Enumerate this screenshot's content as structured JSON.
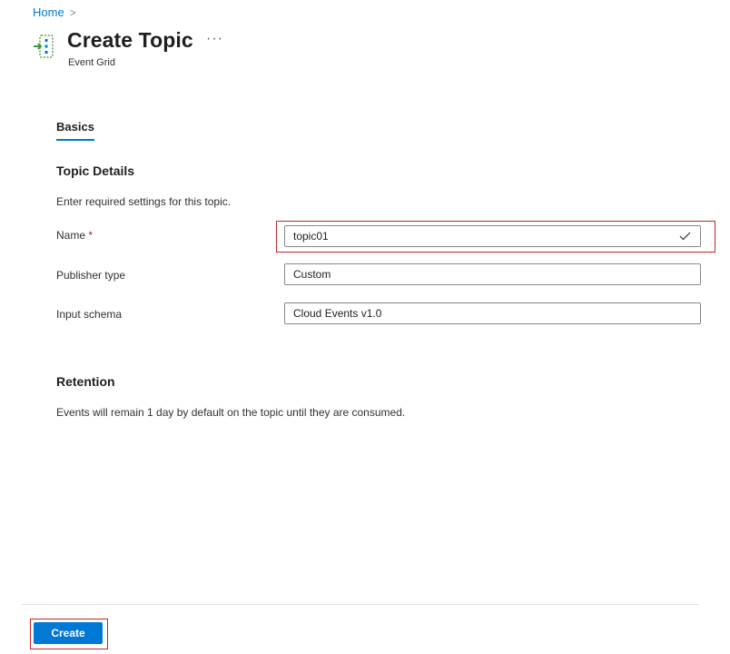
{
  "breadcrumb": {
    "home": "Home",
    "separator": ">"
  },
  "header": {
    "title": "Create Topic",
    "more": "···",
    "subtitle": "Event Grid",
    "icon": "event-grid-topic-icon"
  },
  "tabs": [
    {
      "label": "Basics",
      "active": true
    }
  ],
  "topic_details": {
    "heading": "Topic Details",
    "description": "Enter required settings for this topic.",
    "fields": {
      "name": {
        "label": "Name",
        "required_marker": "*",
        "value": "topic01",
        "valid": true
      },
      "publisher_type": {
        "label": "Publisher type",
        "value": "Custom"
      },
      "input_schema": {
        "label": "Input schema",
        "value": "Cloud Events v1.0"
      }
    }
  },
  "retention": {
    "heading": "Retention",
    "description": "Events will remain 1 day by default on the topic until they are consumed."
  },
  "footer": {
    "create_label": "Create"
  },
  "colors": {
    "accent": "#0078d4",
    "highlight": "#c4262e",
    "required": "#a4262c"
  }
}
